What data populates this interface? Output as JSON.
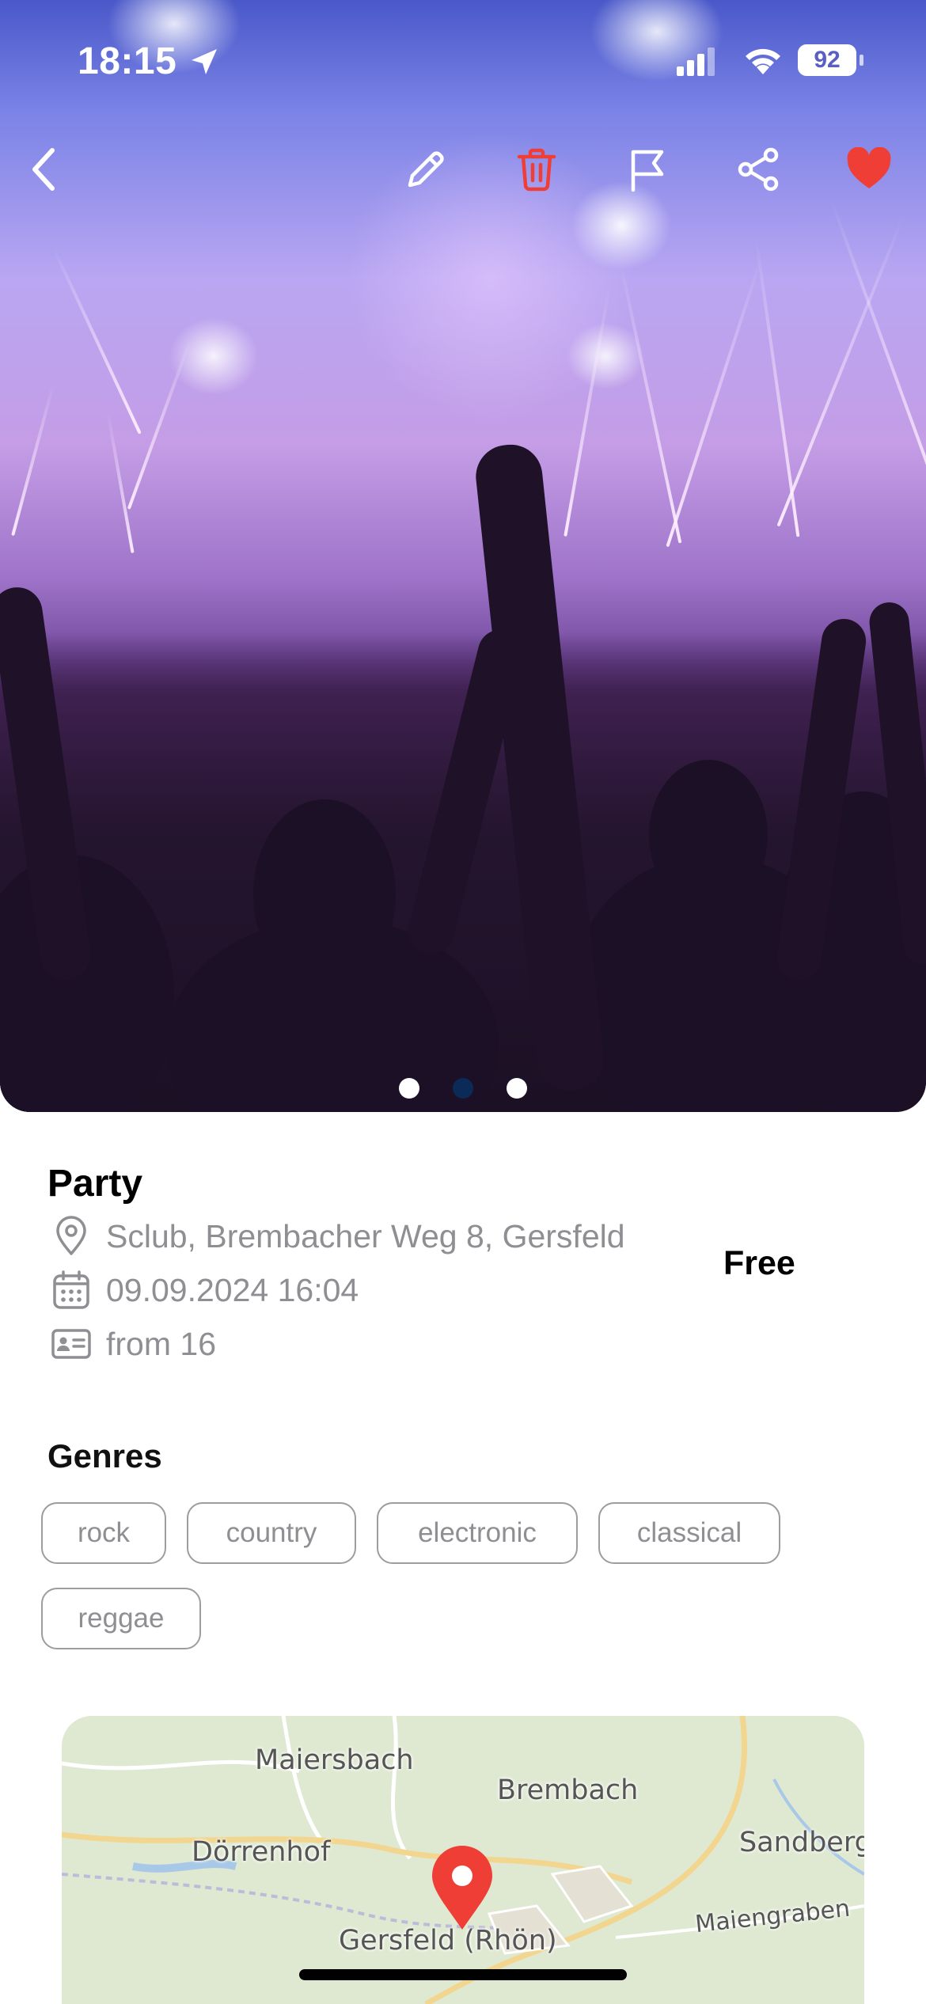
{
  "status_bar": {
    "time": "18:15",
    "battery": "92"
  },
  "top_actions": [
    "back-icon",
    "pencil-icon",
    "trash-icon",
    "flag-icon",
    "share-icon",
    "heart-icon"
  ],
  "colors": {
    "accent_red": "#ef3e36",
    "chip_border": "#9c9ca1",
    "muted_text": "#8e8e93",
    "active_dot": "#0b2a57"
  },
  "carousel": {
    "page_count": 3,
    "active_index": 1
  },
  "event": {
    "title": "Party",
    "location": "Sclub, Brembacher Weg 8, Gersfeld",
    "datetime": "09.09.2024 16:04",
    "age": "from 16",
    "price": "Free"
  },
  "genres": {
    "title": "Genres",
    "items": [
      "rock",
      "country",
      "electronic",
      "classical",
      "reggae"
    ]
  },
  "map": {
    "labels": [
      "Maiersbach",
      "Brembach",
      "Dörrenhof",
      "Sandberg",
      "Maiengraben",
      "Gersfeld (Rhön)"
    ]
  }
}
